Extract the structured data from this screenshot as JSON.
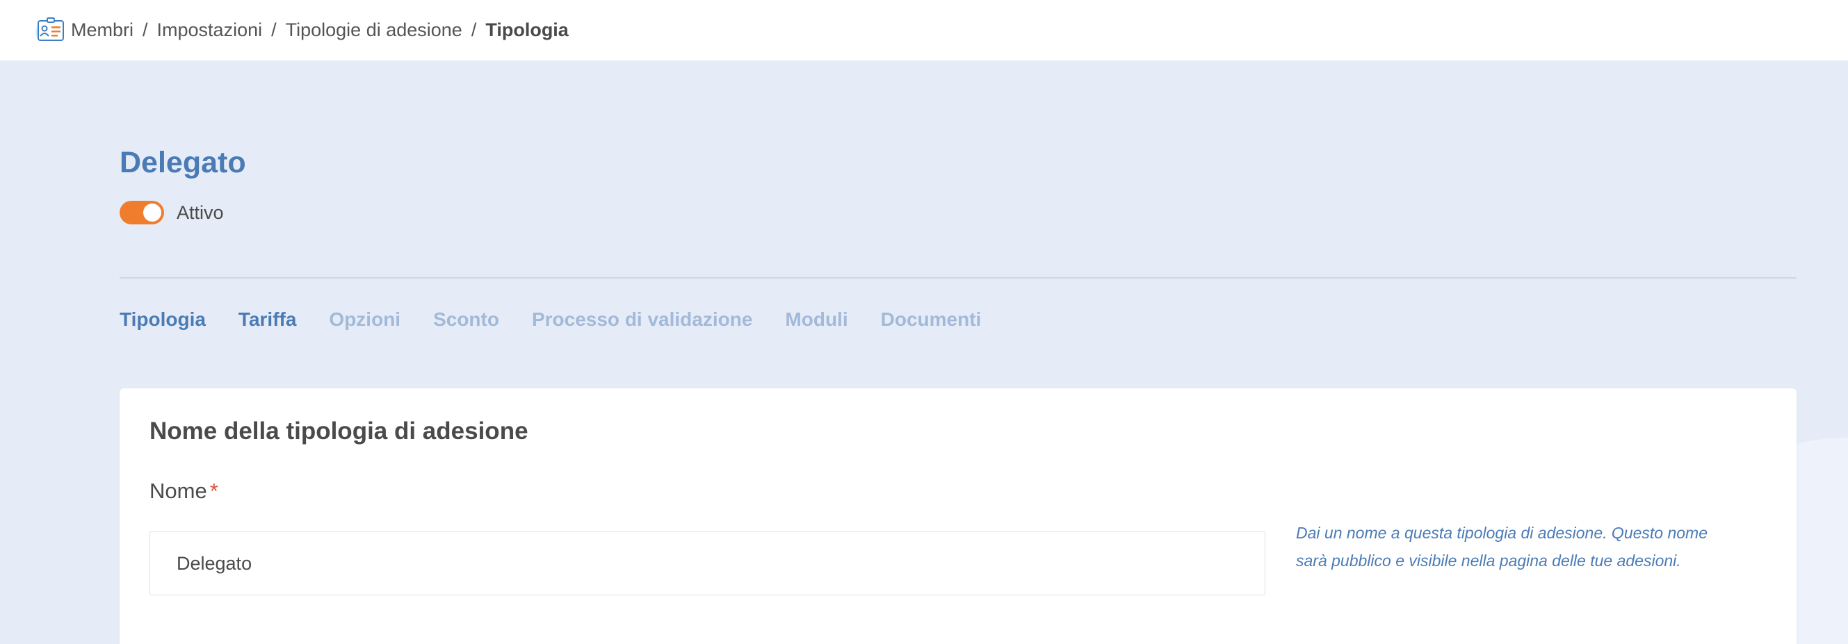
{
  "breadcrumb": {
    "items": [
      "Membri",
      "Impostazioni",
      "Tipologie di adesione"
    ],
    "separator": "/",
    "current": "Tipologia"
  },
  "header": {
    "title": "Delegato",
    "status_label": "Attivo",
    "active": true
  },
  "tabs": [
    {
      "label": "Tipologia",
      "enabled": true
    },
    {
      "label": "Tariffa",
      "enabled": true
    },
    {
      "label": "Opzioni",
      "enabled": false
    },
    {
      "label": "Sconto",
      "enabled": false
    },
    {
      "label": "Processo di validazione",
      "enabled": false
    },
    {
      "label": "Moduli",
      "enabled": false
    },
    {
      "label": "Documenti",
      "enabled": false
    }
  ],
  "card": {
    "title": "Nome della tipologia di adesione",
    "field_label": "Nome",
    "required_marker": "*",
    "field_value": "Delegato",
    "help_text": "Dai un nome a questa tipologia di adesione. Questo nome sarà pubblico e visibile nella pagina delle tue adesioni."
  },
  "colors": {
    "accent": "#4a7bb5",
    "toggle_on": "#ef7d2d",
    "tab_inactive": "#a2b9d9",
    "background": "#e6ecf7",
    "required": "#e0533d"
  },
  "icons": {
    "app": "member-card-icon"
  }
}
